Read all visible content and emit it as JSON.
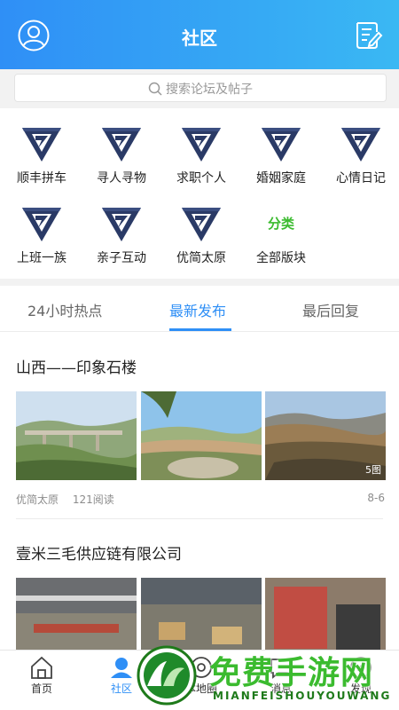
{
  "header": {
    "title": "社区",
    "left_icon": "user-circle-icon",
    "right_icon": "edit-post-icon",
    "color_start": "#2f8ff6",
    "color_end": "#3ab8f3"
  },
  "search": {
    "placeholder": "搜索论坛及帖子",
    "icon": "search-icon"
  },
  "categories": [
    {
      "label": "顺丰拼车",
      "icon": "forum-logo-icon"
    },
    {
      "label": "寻人寻物",
      "icon": "forum-logo-icon"
    },
    {
      "label": "求职个人",
      "icon": "forum-logo-icon"
    },
    {
      "label": "婚姻家庭",
      "icon": "forum-logo-icon"
    },
    {
      "label": "心情日记",
      "icon": "forum-logo-icon"
    },
    {
      "label": "上班一族",
      "icon": "forum-logo-icon"
    },
    {
      "label": "亲子互动",
      "icon": "forum-logo-icon"
    },
    {
      "label": "优简太原",
      "icon": "forum-logo-icon"
    },
    {
      "label": "全部版块",
      "icon": "category-green-icon",
      "icon_text": "分类"
    }
  ],
  "tabs": [
    {
      "label": "24小时热点",
      "active": false
    },
    {
      "label": "最新发布",
      "active": true
    },
    {
      "label": "最后回复",
      "active": false
    }
  ],
  "posts": [
    {
      "title": "山西——印象石楼",
      "image_badge": "5图",
      "forum": "优简太原",
      "reads": "121阅读",
      "date": "8-6"
    },
    {
      "title": "壹米三毛供应链有限公司"
    }
  ],
  "bottom_nav": [
    {
      "label": "首页",
      "icon": "home-icon",
      "active": false
    },
    {
      "label": "社区",
      "icon": "community-icon",
      "active": true
    },
    {
      "label": "本地圈",
      "icon": "local-circle-icon",
      "active": false
    },
    {
      "label": "消息",
      "icon": "message-icon",
      "active": false
    },
    {
      "label": "发现",
      "icon": "discover-icon",
      "active": false
    }
  ],
  "watermark": {
    "text": "免费手游网",
    "subtext": "MIANFEISHOUYOUWANG"
  },
  "colors": {
    "accent": "#2f8ff6",
    "logo_navy": "#2a3a66",
    "green": "#3bbb2f"
  }
}
